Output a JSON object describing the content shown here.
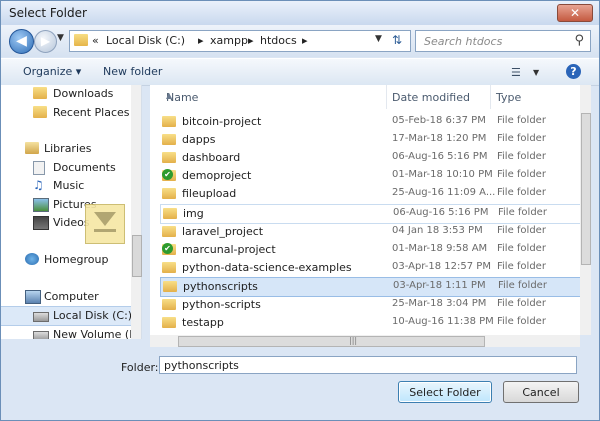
{
  "window": {
    "title": "Select Folder",
    "close_label": "✕"
  },
  "address_bar": {
    "chevrons": "«",
    "crumbs": [
      "Local Disk (C:)",
      "xampp",
      "htdocs"
    ],
    "separator": "▸"
  },
  "search": {
    "placeholder": "Search htdocs"
  },
  "toolbar": {
    "organize": "Organize ▾",
    "new_folder": "New folder",
    "help": "?"
  },
  "nav": {
    "items": [
      {
        "label": "Downloads",
        "icon": "folder-icon"
      },
      {
        "label": "Recent Places",
        "icon": "folder-icon"
      },
      {
        "label": "Libraries",
        "icon": "library-icon"
      },
      {
        "label": "Documents",
        "icon": "documents-icon"
      },
      {
        "label": "Music",
        "icon": "music-icon"
      },
      {
        "label": "Pictures",
        "icon": "pictures-icon"
      },
      {
        "label": "Videos",
        "icon": "videos-icon"
      },
      {
        "label": "Homegroup",
        "icon": "homegroup-icon"
      },
      {
        "label": "Computer",
        "icon": "computer-icon"
      },
      {
        "label": "Local Disk (C:)",
        "icon": "disk-icon"
      },
      {
        "label": "New Volume (D:)",
        "icon": "disk-icon"
      }
    ]
  },
  "columns": {
    "name": "Name",
    "date": "Date modified",
    "type": "Type"
  },
  "files": [
    {
      "name": "bitcoin-project",
      "date": "05-Feb-18 6:37 PM",
      "type": "File folder"
    },
    {
      "name": "dapps",
      "date": "17-Mar-18 1:20 PM",
      "type": "File folder"
    },
    {
      "name": "dashboard",
      "date": "06-Aug-16 5:16 PM",
      "type": "File folder"
    },
    {
      "name": "demoproject",
      "date": "01-Mar-18 10:10 PM",
      "type": "File folder"
    },
    {
      "name": "fileupload",
      "date": "25-Aug-16 11:09 A...",
      "type": "File folder"
    },
    {
      "name": "img",
      "date": "06-Aug-16 5:16 PM",
      "type": "File folder"
    },
    {
      "name": "laravel_project",
      "date": "04 Jan 18 3:53 PM",
      "type": "File folder"
    },
    {
      "name": "marcunal-project",
      "date": "01-Mar-18 9:58 AM",
      "type": "File folder"
    },
    {
      "name": "python-data-science-examples",
      "date": "03-Apr-18 12:57 PM",
      "type": "File folder"
    },
    {
      "name": "pythonscripts",
      "date": "03-Apr-18 1:11 PM",
      "type": "File folder"
    },
    {
      "name": "python-scripts",
      "date": "25-Mar-18 3:04 PM",
      "type": "File folder"
    },
    {
      "name": "testapp",
      "date": "10-Aug-16 11:38 PM",
      "type": "File folder"
    }
  ],
  "footer": {
    "folder_label": "Folder:",
    "folder_value": "pythonscripts",
    "select_button": "Select Folder",
    "cancel_button": "Cancel"
  }
}
